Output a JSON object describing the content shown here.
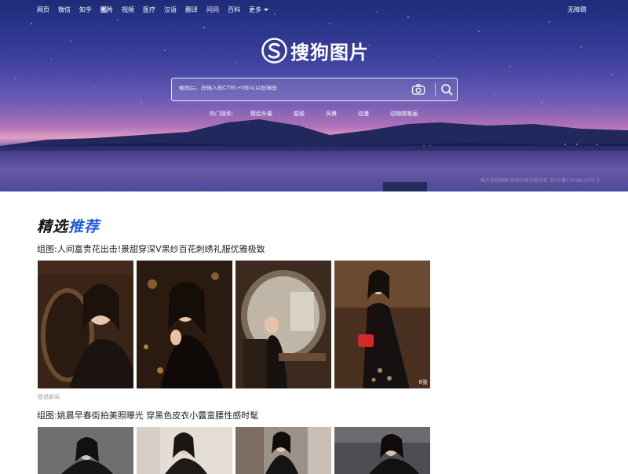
{
  "topnav": {
    "items": [
      {
        "label": "网页"
      },
      {
        "label": "微信"
      },
      {
        "label": "知乎"
      },
      {
        "label": "图片",
        "active": true
      },
      {
        "label": "视频"
      },
      {
        "label": "医疗"
      },
      {
        "label": "汉语"
      },
      {
        "label": "翻译"
      },
      {
        "label": "问问"
      },
      {
        "label": "百科"
      },
      {
        "label": "更多"
      }
    ],
    "no_login": "无障碍"
  },
  "logo": {
    "text": "搜狗图片"
  },
  "search": {
    "placeholder": "截图后，在输入框CTRL+V即可以图搜图",
    "camera_icon": "camera-icon",
    "search_icon": "search-icon"
  },
  "hot": {
    "label": "热门搜索：",
    "links": [
      "情侣头像",
      "壁纸",
      "风景",
      "动漫",
      "动物简笔画"
    ]
  },
  "hero": {
    "credit": "图片来自网络 版权归原作者所有 京ICP备17048165号-5"
  },
  "section": {
    "title_part1": "精选",
    "title_part2": "推荐"
  },
  "groups": [
    {
      "title": "组图:人间富贵花出击!景甜穿深V黑纱百花刺绣礼服优雅极致",
      "count": "8张",
      "source": "图说新闻"
    },
    {
      "title": "组图:姚晨早春街拍美照曝光 穿黑色皮衣小露蛮腰性感时髦"
    }
  ],
  "colors": {
    "accent": "#1e5be0",
    "hero_top": "#1d2c78",
    "hero_horizon": "#e0a0c2"
  }
}
